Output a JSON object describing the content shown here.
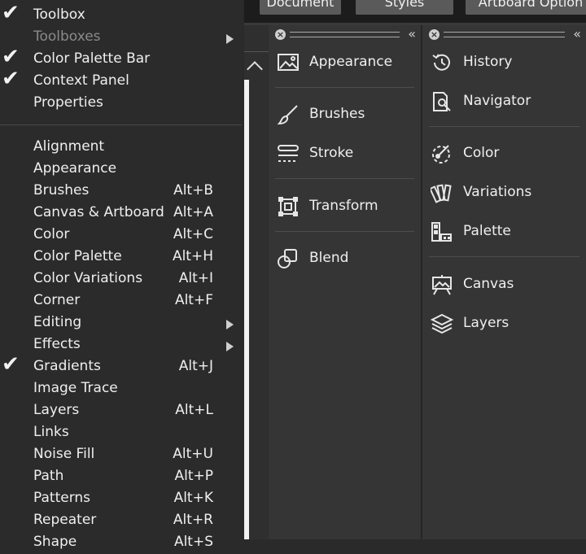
{
  "topbar": {
    "buttons": [
      "Document",
      "Styles",
      "Artboard Option"
    ]
  },
  "menu": {
    "items": [
      {
        "label": "Toolbox",
        "checked": true,
        "shortcut": "",
        "submenu": false,
        "disabled": false
      },
      {
        "label": "Toolboxes",
        "checked": false,
        "shortcut": "",
        "submenu": true,
        "disabled": true
      },
      {
        "label": "Color Palette Bar",
        "checked": true,
        "shortcut": "",
        "submenu": false,
        "disabled": false
      },
      {
        "label": "Context Panel",
        "checked": true,
        "shortcut": "",
        "submenu": false,
        "disabled": false
      },
      {
        "label": "Properties",
        "checked": false,
        "shortcut": "",
        "submenu": false,
        "disabled": false
      },
      {
        "label": "Alignment",
        "checked": false,
        "shortcut": "",
        "submenu": false,
        "disabled": false
      },
      {
        "label": "Appearance",
        "checked": false,
        "shortcut": "",
        "submenu": false,
        "disabled": false
      },
      {
        "label": "Brushes",
        "checked": false,
        "shortcut": "Alt+B",
        "submenu": false,
        "disabled": false
      },
      {
        "label": "Canvas & Artboard",
        "checked": false,
        "shortcut": "Alt+A",
        "submenu": false,
        "disabled": false
      },
      {
        "label": "Color",
        "checked": false,
        "shortcut": "Alt+C",
        "submenu": false,
        "disabled": false
      },
      {
        "label": "Color Palette",
        "checked": false,
        "shortcut": "Alt+H",
        "submenu": false,
        "disabled": false
      },
      {
        "label": "Color Variations",
        "checked": false,
        "shortcut": "Alt+I",
        "submenu": false,
        "disabled": false
      },
      {
        "label": "Corner",
        "checked": false,
        "shortcut": "Alt+F",
        "submenu": false,
        "disabled": false
      },
      {
        "label": "Editing",
        "checked": false,
        "shortcut": "",
        "submenu": true,
        "disabled": false
      },
      {
        "label": "Effects",
        "checked": false,
        "shortcut": "",
        "submenu": true,
        "disabled": false
      },
      {
        "label": "Gradients",
        "checked": true,
        "shortcut": "Alt+J",
        "submenu": false,
        "disabled": false
      },
      {
        "label": "Image Trace",
        "checked": false,
        "shortcut": "",
        "submenu": false,
        "disabled": false
      },
      {
        "label": "Layers",
        "checked": false,
        "shortcut": "Alt+L",
        "submenu": false,
        "disabled": false
      },
      {
        "label": "Links",
        "checked": false,
        "shortcut": "",
        "submenu": false,
        "disabled": false
      },
      {
        "label": "Noise Fill",
        "checked": false,
        "shortcut": "Alt+U",
        "submenu": false,
        "disabled": false
      },
      {
        "label": "Path",
        "checked": false,
        "shortcut": "Alt+P",
        "submenu": false,
        "disabled": false
      },
      {
        "label": "Patterns",
        "checked": false,
        "shortcut": "Alt+K",
        "submenu": false,
        "disabled": false
      },
      {
        "label": "Repeater",
        "checked": false,
        "shortcut": "Alt+R",
        "submenu": false,
        "disabled": false
      },
      {
        "label": "Shape",
        "checked": false,
        "shortcut": "Alt+S",
        "submenu": false,
        "disabled": false
      }
    ]
  },
  "panel_left": {
    "items": [
      {
        "label": "Appearance",
        "icon": "appearance-icon"
      },
      {
        "label": "Brushes",
        "icon": "brush-icon"
      },
      {
        "label": "Stroke",
        "icon": "stroke-icon"
      },
      {
        "label": "Transform",
        "icon": "transform-icon"
      },
      {
        "label": "Blend",
        "icon": "blend-icon"
      }
    ]
  },
  "panel_right": {
    "items": [
      {
        "label": "History",
        "icon": "history-icon"
      },
      {
        "label": "Navigator",
        "icon": "navigator-icon"
      },
      {
        "label": "Color",
        "icon": "color-icon"
      },
      {
        "label": "Variations",
        "icon": "variations-icon"
      },
      {
        "label": "Palette",
        "icon": "palette-icon"
      },
      {
        "label": "Canvas",
        "icon": "canvas-icon"
      },
      {
        "label": "Layers",
        "icon": "layers-icon"
      }
    ]
  }
}
